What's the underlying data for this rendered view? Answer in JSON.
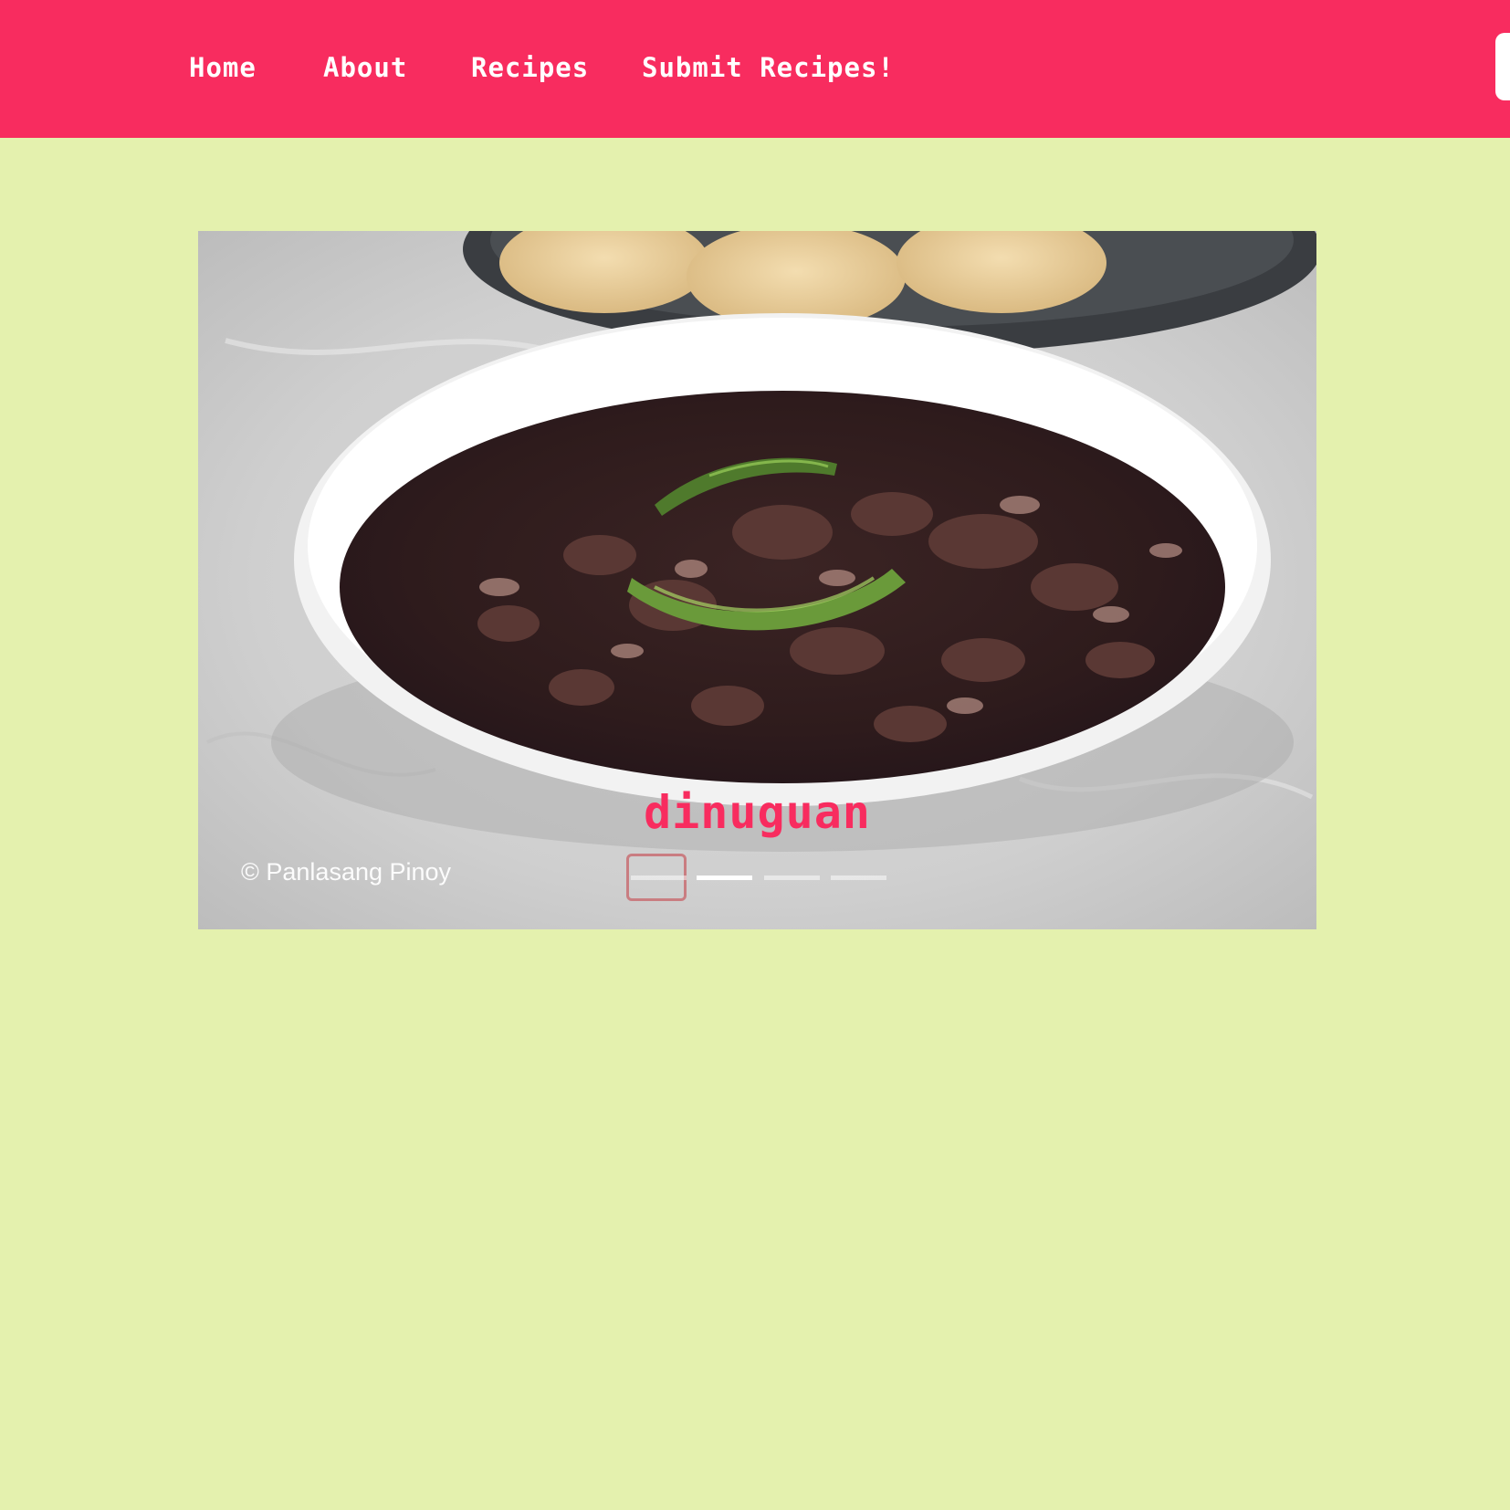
{
  "nav": {
    "items": [
      {
        "label": "Home"
      },
      {
        "label": "About"
      },
      {
        "label": "Recipes"
      },
      {
        "label": "Submit Recipes!"
      }
    ]
  },
  "carousel": {
    "active_index": 1,
    "slides": [
      {
        "title": "dinuguan",
        "credit": "© Panlasang Pinoy"
      }
    ],
    "indicator_count": 4
  },
  "colors": {
    "navbar": "#f82c5f",
    "page_background": "#e4f1ae",
    "caption_text": "#f82c5f"
  }
}
